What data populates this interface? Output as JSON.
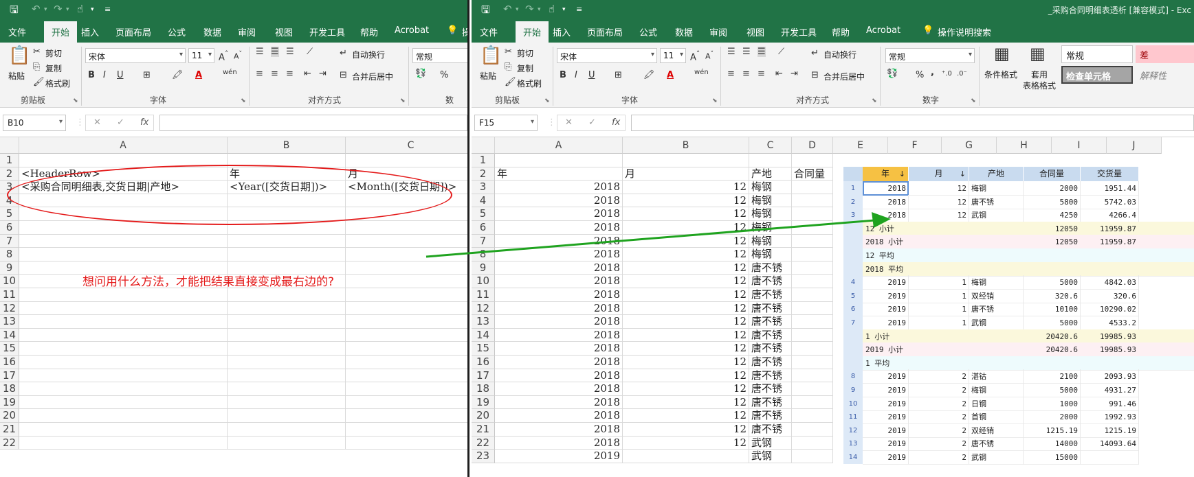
{
  "left": {
    "qat": {
      "save_icon": "save-icon",
      "undo_icon": "undo-icon",
      "redo_icon": "redo-icon",
      "touch_icon": "touch-mode-icon",
      "customize_icon": "customize-qat-icon"
    },
    "tabs": [
      "文件",
      "开始",
      "插入",
      "页面布局",
      "公式",
      "数据",
      "审阅",
      "视图",
      "开发工具",
      "帮助",
      "Acrobat"
    ],
    "active_tab": "开始",
    "tell_me_partial": "操",
    "clipboard": {
      "paste": "粘贴",
      "cut": "剪切",
      "copy": "复制",
      "format_painter": "格式刷",
      "group": "剪贴板"
    },
    "font": {
      "name": "宋体",
      "size": "11",
      "group": "字体",
      "bold": "B",
      "italic": "I",
      "underline": "U",
      "phonetic": "wén"
    },
    "alignment": {
      "wrap": "自动换行",
      "merge": "合并后居中",
      "group": "对齐方式"
    },
    "number": {
      "format": "常规",
      "group_partial": "数"
    },
    "namebox": "B10",
    "fx": "fx",
    "columns": [
      "A",
      "B",
      "C"
    ],
    "rows": [
      "1",
      "2",
      "3",
      "4",
      "5",
      "6",
      "7",
      "8",
      "9",
      "10",
      "11",
      "12",
      "13",
      "14",
      "15",
      "16",
      "17",
      "18",
      "19",
      "20",
      "21",
      "22"
    ],
    "cells": {
      "a2": "<HeaderRow>",
      "b2": "年",
      "c2": "月",
      "a3": "<采购合同明细表,交货日期|产地>",
      "b3": "<Year([交货日期])>",
      "c3": "<Month([交货日期])>"
    },
    "question": "想问用什么方法，才能把结果直接变成最右边的?",
    "annotation_color": "#e41a1a"
  },
  "right": {
    "title": "_采购合同明细表透析 [兼容模式] - Exc",
    "tabs": [
      "文件",
      "开始",
      "插入",
      "页面布局",
      "公式",
      "数据",
      "审阅",
      "视图",
      "开发工具",
      "帮助",
      "Acrobat"
    ],
    "active_tab": "开始",
    "tell_me": "操作说明搜索",
    "clipboard": {
      "paste": "粘贴",
      "cut": "剪切",
      "copy": "复制",
      "format_painter": "格式刷",
      "group": "剪贴板"
    },
    "font": {
      "name": "宋体",
      "size": "11",
      "group": "字体",
      "bold": "B",
      "italic": "I",
      "underline": "U",
      "phonetic": "wén"
    },
    "alignment": {
      "wrap": "自动换行",
      "merge": "合并后居中",
      "group": "对齐方式"
    },
    "number": {
      "format": "常规",
      "group": "数字",
      "percent": "%",
      "comma": ","
    },
    "styles": {
      "conditional": "条件格式",
      "table_format_1": "套用",
      "table_format_2": "表格格式",
      "normal": "常规",
      "bad": "差",
      "check_cell": "检查单元格",
      "explanatory": "解释性"
    },
    "namebox": "F15",
    "fx": "fx",
    "columns": [
      "A",
      "B",
      "C",
      "D",
      "E",
      "F",
      "G",
      "H",
      "I",
      "J"
    ],
    "rows": [
      "1",
      "2",
      "3",
      "4",
      "5",
      "6",
      "7",
      "8",
      "9",
      "10",
      "11",
      "12",
      "13",
      "14",
      "15",
      "16",
      "17",
      "18",
      "19",
      "20",
      "21",
      "22",
      "23"
    ],
    "header_row": {
      "a": "年",
      "b": "月",
      "c": "产地",
      "d": "合同量"
    },
    "data_rows": [
      {
        "year": "2018",
        "month": "12",
        "origin": "梅钢"
      },
      {
        "year": "2018",
        "month": "12",
        "origin": "梅钢"
      },
      {
        "year": "2018",
        "month": "12",
        "origin": "梅钢"
      },
      {
        "year": "2018",
        "month": "12",
        "origin": "梅钢"
      },
      {
        "year": "2018",
        "month": "12",
        "origin": "梅钢"
      },
      {
        "year": "2018",
        "month": "12",
        "origin": "梅钢"
      },
      {
        "year": "2018",
        "month": "12",
        "origin": "唐不锈"
      },
      {
        "year": "2018",
        "month": "12",
        "origin": "唐不锈"
      },
      {
        "year": "2018",
        "month": "12",
        "origin": "唐不锈"
      },
      {
        "year": "2018",
        "month": "12",
        "origin": "唐不锈"
      },
      {
        "year": "2018",
        "month": "12",
        "origin": "唐不锈"
      },
      {
        "year": "2018",
        "month": "12",
        "origin": "唐不锈"
      },
      {
        "year": "2018",
        "month": "12",
        "origin": "唐不锈"
      },
      {
        "year": "2018",
        "month": "12",
        "origin": "唐不锈"
      },
      {
        "year": "2018",
        "month": "12",
        "origin": "唐不锈"
      },
      {
        "year": "2018",
        "month": "12",
        "origin": "唐不锈"
      },
      {
        "year": "2018",
        "month": "12",
        "origin": "唐不锈"
      },
      {
        "year": "2018",
        "month": "12",
        "origin": "唐不锈"
      },
      {
        "year": "2018",
        "month": "12",
        "origin": "唐不锈"
      },
      {
        "year": "2018",
        "month": "12",
        "origin": "武钢"
      },
      {
        "year": "2019",
        "month": "",
        "origin": "武钢"
      }
    ],
    "arrow_color": "#1fa31f"
  },
  "report": {
    "headers": [
      "年",
      "月",
      "产地",
      "合同量",
      "交货量"
    ],
    "header_colors": {
      "selected": "#f6c143",
      "normal": "#c9dbef",
      "subtotal": "#fbf8dc",
      "year_subtotal": "#fdf0f3",
      "average": "#eefbfd"
    },
    "rows": [
      {
        "kind": "data",
        "n": "1",
        "year": "2018",
        "month": "12",
        "origin": "梅钢",
        "contract": "2000",
        "delivered": "1951.44"
      },
      {
        "kind": "data",
        "n": "2",
        "year": "2018",
        "month": "12",
        "origin": "唐不锈",
        "contract": "5800",
        "delivered": "5742.03"
      },
      {
        "kind": "data",
        "n": "3",
        "year": "2018",
        "month": "12",
        "origin": "武钢",
        "contract": "4250",
        "delivered": "4266.4"
      },
      {
        "kind": "subtotal",
        "label": "12 小计",
        "contract": "12050",
        "delivered": "11959.87"
      },
      {
        "kind": "year_subtotal",
        "label": "2018 小计",
        "contract": "12050",
        "delivered": "11959.87"
      },
      {
        "kind": "average",
        "label": "12 平均",
        "contract": "",
        "delivered": ""
      },
      {
        "kind": "subtotal",
        "label": "2018 平均",
        "contract": "",
        "delivered": ""
      },
      {
        "kind": "data",
        "n": "4",
        "year": "2019",
        "month": "1",
        "origin": "梅钢",
        "contract": "5000",
        "delivered": "4842.03"
      },
      {
        "kind": "data",
        "n": "5",
        "year": "2019",
        "month": "1",
        "origin": "双经销",
        "contract": "320.6",
        "delivered": "320.6"
      },
      {
        "kind": "data",
        "n": "6",
        "year": "2019",
        "month": "1",
        "origin": "唐不锈",
        "contract": "10100",
        "delivered": "10290.02"
      },
      {
        "kind": "data",
        "n": "7",
        "year": "2019",
        "month": "1",
        "origin": "武钢",
        "contract": "5000",
        "delivered": "4533.2"
      },
      {
        "kind": "subtotal",
        "label": "1 小计",
        "contract": "20420.6",
        "delivered": "19985.93"
      },
      {
        "kind": "year_subtotal",
        "label": "2019 小计",
        "contract": "20420.6",
        "delivered": "19985.93"
      },
      {
        "kind": "average",
        "label": "1 平均",
        "contract": "",
        "delivered": ""
      },
      {
        "kind": "data",
        "n": "8",
        "year": "2019",
        "month": "2",
        "origin": "湛钴",
        "contract": "2100",
        "delivered": "2093.93"
      },
      {
        "kind": "data",
        "n": "9",
        "year": "2019",
        "month": "2",
        "origin": "梅钢",
        "contract": "5000",
        "delivered": "4931.27"
      },
      {
        "kind": "data",
        "n": "10",
        "year": "2019",
        "month": "2",
        "origin": "日钢",
        "contract": "1000",
        "delivered": "991.46"
      },
      {
        "kind": "data",
        "n": "11",
        "year": "2019",
        "month": "2",
        "origin": "首钢",
        "contract": "2000",
        "delivered": "1992.93"
      },
      {
        "kind": "data",
        "n": "12",
        "year": "2019",
        "month": "2",
        "origin": "双经销",
        "contract": "1215.19",
        "delivered": "1215.19"
      },
      {
        "kind": "data",
        "n": "13",
        "year": "2019",
        "month": "2",
        "origin": "唐不锈",
        "contract": "14000",
        "delivered": "14093.64"
      },
      {
        "kind": "data",
        "n": "14",
        "year": "2019",
        "month": "2",
        "origin": "武钢",
        "contract": "15000",
        "delivered": ""
      }
    ]
  }
}
